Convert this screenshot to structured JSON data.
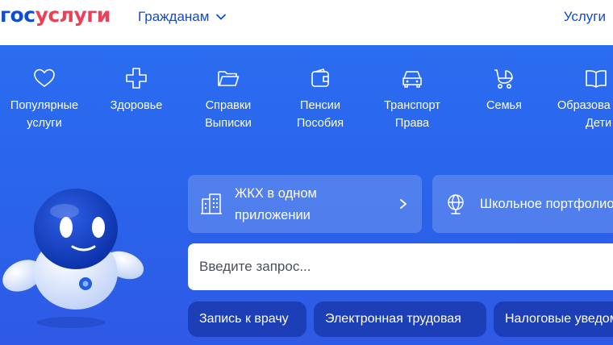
{
  "header": {
    "logo_part1": "гос",
    "logo_part2": "услуги",
    "nav_citizens": "Гражданам",
    "nav_services": "Услуги",
    "colors": {
      "brand_blue": "#0d4cd3",
      "brand_red": "#ee3f58"
    }
  },
  "categories": [
    {
      "line1": "Популярные",
      "line2": "услуги",
      "icon": "heart-icon"
    },
    {
      "line1": "Здоровье",
      "line2": "",
      "icon": "plus-cross-icon"
    },
    {
      "line1": "Справки",
      "line2": "Выписки",
      "icon": "folder-icon"
    },
    {
      "line1": "Пенсии",
      "line2": "Пособия",
      "icon": "wallet-icon"
    },
    {
      "line1": "Транспорт",
      "line2": "Права",
      "icon": "car-icon"
    },
    {
      "line1": "Семья",
      "line2": "",
      "icon": "stroller-icon"
    },
    {
      "line1": "Образова",
      "line2": "Дети",
      "icon": "book-icon"
    }
  ],
  "promo": {
    "card1": {
      "line1": "ЖКХ в одном",
      "line2": "приложении",
      "icon": "building-icon"
    },
    "card2": {
      "text": "Школьное портфолио",
      "icon": "globe-icon"
    }
  },
  "search": {
    "placeholder": "Введите запрос..."
  },
  "chips": [
    "Запись к врачу",
    "Электронная трудовая",
    "Налоговые уведомления"
  ],
  "hero_color": "#2b6df0"
}
